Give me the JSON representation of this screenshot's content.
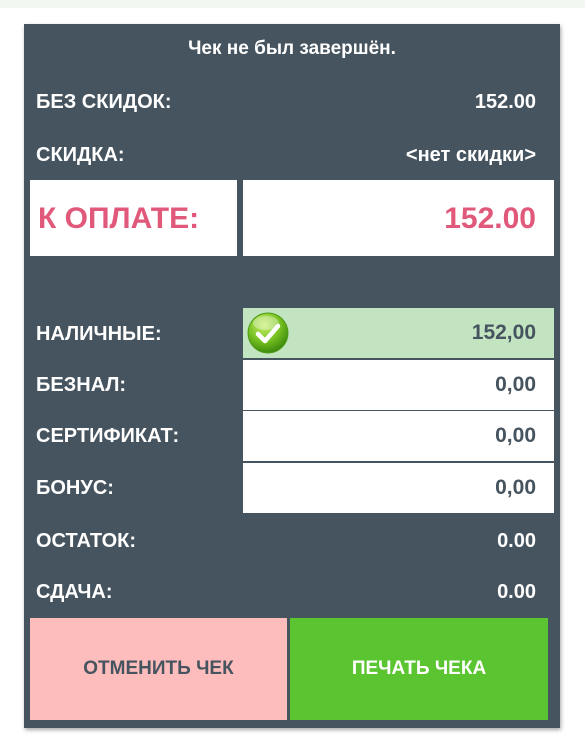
{
  "title": "Чек не был завершён.",
  "summary": {
    "no_discount_label": "БЕЗ СКИДОК:",
    "no_discount_value": "152.00",
    "discount_label": "СКИДКА:",
    "discount_value": "<нет скидки>",
    "due_label": "К ОПЛАТЕ:",
    "due_value": "152.00"
  },
  "payments": [
    {
      "label": "НАЛИЧНЫЕ:",
      "value": "152,00",
      "selected": true
    },
    {
      "label": "БЕЗНАЛ:",
      "value": "0,00",
      "selected": false
    },
    {
      "label": "СЕРТИФИКАТ:",
      "value": "0,00",
      "selected": false
    },
    {
      "label": "БОНУС:",
      "value": "0,00",
      "selected": false
    }
  ],
  "totals": {
    "remainder_label": "ОСТАТОК:",
    "remainder_value": "0.00",
    "change_label": "СДАЧА:",
    "change_value": "0.00"
  },
  "buttons": {
    "cancel_label": "ОТМЕНИТЬ ЧЕК",
    "print_label": "ПЕЧАТЬ ЧЕКА"
  },
  "colors": {
    "panel": "#46545f",
    "due_accent": "#e0587a",
    "selected_payment": "#c2e4c0",
    "cancel_button": "#fdbdbd",
    "print_button": "#5ac531"
  }
}
